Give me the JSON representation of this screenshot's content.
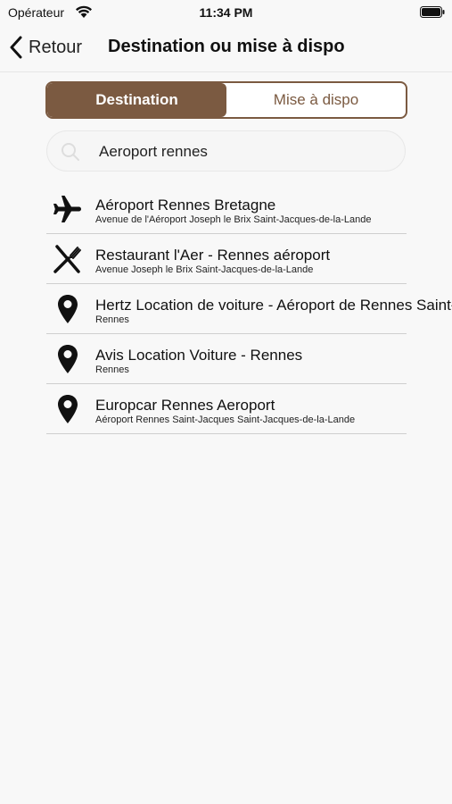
{
  "status_bar": {
    "carrier": "Opérateur",
    "time": "11:34 PM"
  },
  "nav": {
    "back_label": "Retour",
    "title": "Destination ou mise à dispo"
  },
  "segments": {
    "destination": "Destination",
    "mise_a_dispo": "Mise à dispo",
    "selected": "destination"
  },
  "search": {
    "value": "Aeroport rennes"
  },
  "results": [
    {
      "icon": "airplane-icon",
      "title": "Aéroport Rennes Bretagne",
      "subtitle": "Avenue de l'Aéroport Joseph le Brix Saint-Jacques-de-la-Lande"
    },
    {
      "icon": "restaurant-icon",
      "title": "Restaurant l'Aer - Rennes aéroport",
      "subtitle": "Avenue Joseph le Brix Saint-Jacques-de-la-Lande"
    },
    {
      "icon": "map-pin-icon",
      "title": "Hertz Location de voiture - Aéroport de Rennes Saint-Jacques",
      "subtitle": "Rennes"
    },
    {
      "icon": "map-pin-icon",
      "title": "Avis Location Voiture - Rennes",
      "subtitle": "Rennes"
    },
    {
      "icon": "map-pin-icon",
      "title": "Europcar Rennes Aeroport",
      "subtitle": "Aéroport Rennes Saint-Jacques Saint-Jacques-de-la-Lande"
    }
  ],
  "colors": {
    "accent": "#7b5a41",
    "background": "#f8f8f8"
  }
}
